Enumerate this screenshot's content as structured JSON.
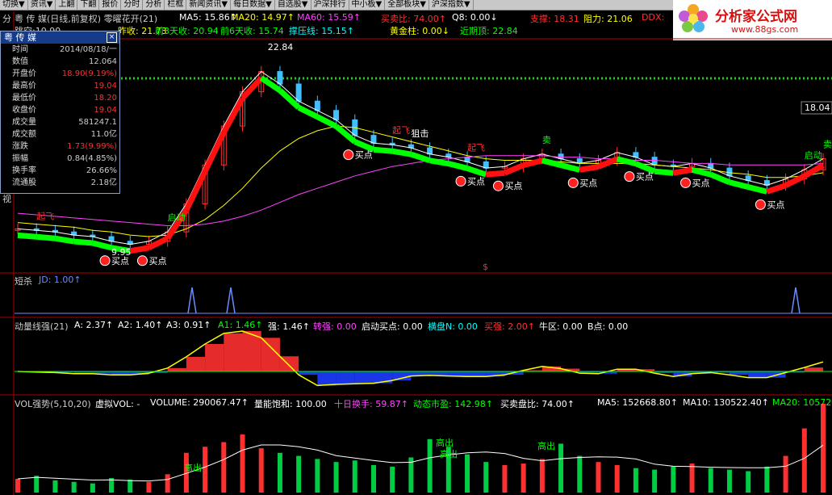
{
  "toolbar": {
    "items": [
      "切换▼",
      "资讯▼",
      "上翻",
      "下翻",
      "报价",
      "分时",
      "分析",
      "栏框",
      "新闻资讯▼",
      "每日数据▼",
      "自选股▼",
      "沪深排行",
      "中小板▼",
      "全部板块▼",
      "沪深指数▼"
    ]
  },
  "watermark": {
    "title": "分析家公式网",
    "url": "www.88gs.com"
  },
  "sidebar_tab": {
    "top": "分",
    "bottom": "视"
  },
  "header": {
    "row1": [
      {
        "text": "粤 传 媒(日线,前复权) 零曜花开(21)",
        "color": "#cccccc"
      },
      {
        "text": "MA5: 15.86↑",
        "color": "#ffffff"
      },
      {
        "text": "MA20: 14.97↑",
        "color": "#ffff00"
      },
      {
        "text": "MA60: 15.59↑",
        "color": "#ff44ff"
      },
      {
        "text": "买卖比: 74.00↑",
        "color": "#ff3030"
      },
      {
        "text": "Q8: 0.00↓",
        "color": "#ffffff"
      },
      {
        "text": "支撑: 18.31",
        "color": "#ff3030"
      },
      {
        "text": "阻力: 21.06",
        "color": "#ffff00"
      },
      {
        "text": "DDX:",
        "color": "#ff3030"
      }
    ],
    "row2": [
      {
        "text": "跳空:10.90",
        "color": "#cccccc"
      },
      {
        "text": "昨收: 21.73",
        "color": "#ffff00"
      },
      {
        "text": "前3天收: 20.94",
        "color": "#00ff00"
      },
      {
        "text": "前6天收: 15.74",
        "color": "#00ff00"
      },
      {
        "text": "撑压线: 15.15↑",
        "color": "#00ffff"
      },
      {
        "text": "黄金柱: 0.00↓",
        "color": "#ffff00"
      },
      {
        "text": "近期顶: 22.84",
        "color": "#00ff00"
      }
    ]
  },
  "info_panel": {
    "title": "粤 传 媒",
    "rows": [
      {
        "label": "时间",
        "value": "2014/08/18/一",
        "color": "#cccccc"
      },
      {
        "label": "数值",
        "value": "12.064",
        "color": "#cccccc"
      },
      {
        "label": "开盘价",
        "value": "18.90(9.19%)",
        "color": "#ff3030"
      },
      {
        "label": "最高价",
        "value": "19.04",
        "color": "#ff3030"
      },
      {
        "label": "最低价",
        "value": "18.20",
        "color": "#ff3030"
      },
      {
        "label": "收盘价",
        "value": "19.04",
        "color": "#ff3030"
      },
      {
        "label": "成交量",
        "value": "581247.1",
        "color": "#cccccc"
      },
      {
        "label": "成交额",
        "value": "11.0亿",
        "color": "#cccccc"
      },
      {
        "label": "涨跌",
        "value": "1.73(9.99%)",
        "color": "#ff3030"
      },
      {
        "label": "振幅",
        "value": "0.84(4.85%)",
        "color": "#cccccc"
      },
      {
        "label": "换手率",
        "value": "26.66%",
        "color": "#cccccc"
      },
      {
        "label": "流通股",
        "value": "2.18亿",
        "color": "#cccccc"
      }
    ]
  },
  "main_chart": {
    "peak_label": "22.84",
    "low_label": "9.95",
    "right_price": "18.04",
    "dollar_mark": "$",
    "annotations": [
      {
        "text": "起飞",
        "color": "#ff3030"
      },
      {
        "text": "启动",
        "color": "#00ff00"
      },
      {
        "text": "买点",
        "color": "#ffffff"
      },
      {
        "text": "买点",
        "color": "#ffffff"
      },
      {
        "text": "起飞",
        "color": "#ff3030"
      },
      {
        "text": "买点",
        "color": "#ffffff"
      },
      {
        "text": "狙击",
        "color": "#ffffff"
      },
      {
        "text": "买点",
        "color": "#ffffff"
      },
      {
        "text": "买点",
        "color": "#ffffff"
      },
      {
        "text": "起飞",
        "color": "#ff3030"
      },
      {
        "text": "卖",
        "color": "#00ff00"
      },
      {
        "text": "买点",
        "color": "#ffffff"
      },
      {
        "text": "买点",
        "color": "#ffffff"
      },
      {
        "text": "买点",
        "color": "#ffffff"
      },
      {
        "text": "买点",
        "color": "#ffffff"
      },
      {
        "text": "启动",
        "color": "#00ff00"
      },
      {
        "text": "卖",
        "color": "#00ff00"
      }
    ]
  },
  "pane_short": {
    "title": "短杀",
    "value": "JD: 1.00↑"
  },
  "pane_momentum": {
    "items": [
      {
        "text": "动量线强(21)",
        "color": "#cccccc"
      },
      {
        "text": "A: 2.37↑",
        "color": "#ffffff"
      },
      {
        "text": "A2: 1.40↑",
        "color": "#ffffff"
      },
      {
        "text": "A3: 0.91↑",
        "color": "#ffffff"
      },
      {
        "text": "A1: 1.46↑",
        "color": "#00ff00"
      },
      {
        "text": "强: 1.46↑",
        "color": "#ffffff"
      },
      {
        "text": "转强: 0.00",
        "color": "#ff44ff"
      },
      {
        "text": "启动买点: 0.00",
        "color": "#ffffff"
      },
      {
        "text": "横盘N: 0.00",
        "color": "#00ffff"
      },
      {
        "text": "买强: 2.00↑",
        "color": "#ff3030"
      },
      {
        "text": "牛区: 0.00",
        "color": "#ffffff"
      },
      {
        "text": "B点: 0.00",
        "color": "#ffffff"
      }
    ]
  },
  "pane_volume": {
    "items": [
      {
        "text": "VOL强势(5,10,20)",
        "color": "#cccccc"
      },
      {
        "text": "虚拟VOL: -",
        "color": "#ffffff"
      },
      {
        "text": "VOLUME: 290067.47↑",
        "color": "#ffffff"
      },
      {
        "text": "量能饱和: 100.00",
        "color": "#ffffff"
      },
      {
        "text": "十日换手: 59.87↑",
        "color": "#ff44ff"
      },
      {
        "text": "动态市盈: 142.98↑",
        "color": "#00ff00"
      },
      {
        "text": "买卖盘比: 74.00↑",
        "color": "#ffffff"
      },
      {
        "text": "MA5: 152668.80↑",
        "color": "#ffffff"
      },
      {
        "text": "MA10: 130522.40↑",
        "color": "#ffffff"
      },
      {
        "text": "MA20: 10572",
        "color": "#00ff00"
      }
    ],
    "annotations": [
      "高出",
      "高出",
      "高出",
      "高出"
    ]
  },
  "chart_data": [
    {
      "type": "line",
      "title": "粤 传 媒(日线,前复权)",
      "series": [
        {
          "name": "MA5",
          "values": [
            11.4,
            11.3,
            11.2,
            11.0,
            10.9,
            10.6,
            10.4,
            10.6,
            11.2,
            13.0,
            15.5,
            18.0,
            20.2,
            21.5,
            20.7,
            19.6,
            19.0,
            18.4,
            17.4,
            16.9,
            16.8,
            16.6,
            16.2,
            16.0,
            15.7,
            15.3,
            15.4,
            15.9,
            16.2,
            15.9,
            15.6,
            15.8,
            16.3,
            16.0,
            15.5,
            15.4,
            15.6,
            15.3,
            14.8,
            14.5,
            14.2,
            14.6,
            15.2,
            15.9
          ]
        },
        {
          "name": "MA20",
          "values": [
            11.8,
            11.7,
            11.6,
            11.5,
            11.3,
            11.2,
            11.0,
            10.9,
            11.0,
            11.4,
            12.0,
            12.9,
            14.0,
            15.3,
            16.4,
            17.2,
            17.7,
            18.0,
            17.9,
            17.6,
            17.3,
            17.0,
            16.7,
            16.4,
            16.1,
            15.9,
            15.8,
            15.8,
            15.8,
            15.7,
            15.6,
            15.6,
            15.6,
            15.6,
            15.5,
            15.4,
            15.3,
            15.2,
            15.0,
            14.9,
            14.7,
            14.7,
            14.8,
            15.0
          ]
        },
        {
          "name": "MA60",
          "values": [
            12.4,
            12.3,
            12.2,
            12.1,
            12.0,
            11.9,
            11.8,
            11.7,
            11.6,
            11.6,
            11.7,
            11.9,
            12.2,
            12.6,
            13.1,
            13.6,
            14.0,
            14.4,
            14.8,
            15.1,
            15.4,
            15.6,
            15.8,
            15.9,
            16.0,
            16.1,
            16.1,
            16.1,
            16.1,
            16.0,
            16.0,
            15.9,
            15.9,
            15.8,
            15.8,
            15.7,
            15.6,
            15.6,
            15.5,
            15.5,
            15.5,
            15.5,
            15.5,
            15.6
          ]
        }
      ],
      "ylim": [
        9.5,
        23.5
      ]
    },
    {
      "type": "bar",
      "title": "VOL强势(5,10,20)",
      "values": [
        90000,
        110000,
        80000,
        70000,
        60000,
        95000,
        85000,
        70000,
        120000,
        260000,
        300000,
        330000,
        380000,
        290000,
        260000,
        240000,
        220000,
        200000,
        210000,
        180000,
        170000,
        230000,
        350000,
        300000,
        250000,
        200000,
        180000,
        190000,
        220000,
        320000,
        240000,
        200000,
        180000,
        160000,
        150000,
        170000,
        190000,
        160000,
        150000,
        140000,
        170000,
        240000,
        420000,
        581247
      ]
    }
  ]
}
